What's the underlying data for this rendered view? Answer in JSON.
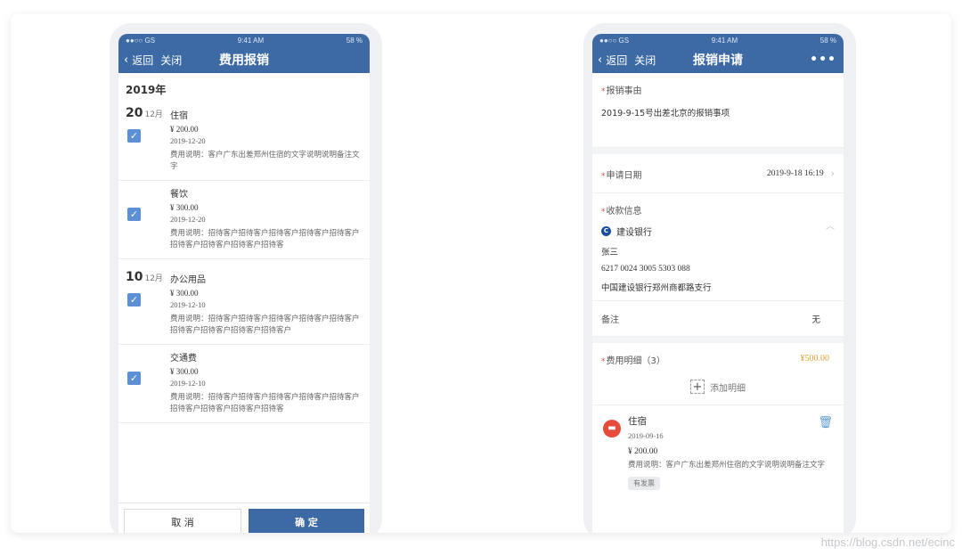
{
  "status": {
    "signal": "●●○○ GS",
    "time": "9:41 AM",
    "battery": "58 %"
  },
  "left": {
    "nav": {
      "back": "返回",
      "close": "关闭",
      "title": "费用报销"
    },
    "year": "2019年",
    "groups": [
      {
        "day": "20",
        "month": "12月",
        "items": [
          {
            "name": "住宿",
            "amount": "¥ 200.00",
            "date": "2019-12-20",
            "desc": "费用说明：客户广东出差郑州住宿的文字说明说明备注文字"
          },
          {
            "name": "餐饮",
            "amount": "¥ 300.00",
            "date": "2019-12-20",
            "desc": "费用说明：招待客户招待客户招待客户招待客户招待客户招待客户招待客户招待客户招待客"
          }
        ]
      },
      {
        "day": "10",
        "month": "12月",
        "items": [
          {
            "name": "办公用品",
            "amount": "¥ 300.00",
            "date": "2019-12-10",
            "desc": "费用说明：招待客户招待客户招待客户招待客户招待客户招待客户招待客户招待客户招待客户"
          },
          {
            "name": "交通费",
            "amount": "¥ 300.00",
            "date": "2019-12-10",
            "desc": "费用说明：招待客户招待客户招待客户招待客户招待客户招待客户招待客户招待客户招待客"
          }
        ]
      }
    ],
    "buttons": {
      "cancel": "取 消",
      "ok": "确 定"
    }
  },
  "right": {
    "nav": {
      "back": "返回",
      "close": "关闭",
      "title": "报销申请",
      "more": "•••"
    },
    "reason": {
      "label": "报销事由",
      "value": "2019-9-15号出差北京的报销事项"
    },
    "apply_date": {
      "label": "申请日期",
      "value": "2019-9-18  16:19"
    },
    "payee": {
      "label": "收款信息",
      "bank": "建设银行",
      "name": "张三",
      "account": "6217 0024 3005 5303 088",
      "branch": "中国建设银行郑州商都路支行"
    },
    "remark": {
      "label": "备注",
      "value": "无"
    },
    "details": {
      "label": "费用明细（3）",
      "total": "¥500.00",
      "add": "添加明细"
    },
    "detail_item": {
      "name": "住宿",
      "date": "2019-09-16",
      "amount": "¥ 200.00",
      "desc": "费用说明：客户广东出差郑州住宿的文字说明说明备注文字",
      "tag": "有发票"
    }
  },
  "watermark": "https://blog.csdn.net/ecinc",
  "colors": {
    "nav": "#3d6aa5",
    "checkbox": "#5b8fd6",
    "total": "#e2a23a",
    "hotel_icon": "#e64c3c"
  },
  "icons": [
    "chevron-left-icon",
    "checkbox-checked-icon",
    "chevron-right-icon",
    "chevron-up-icon",
    "bank-logo-icon",
    "add-icon",
    "hotel-icon",
    "trash-icon",
    "more-icon"
  ]
}
